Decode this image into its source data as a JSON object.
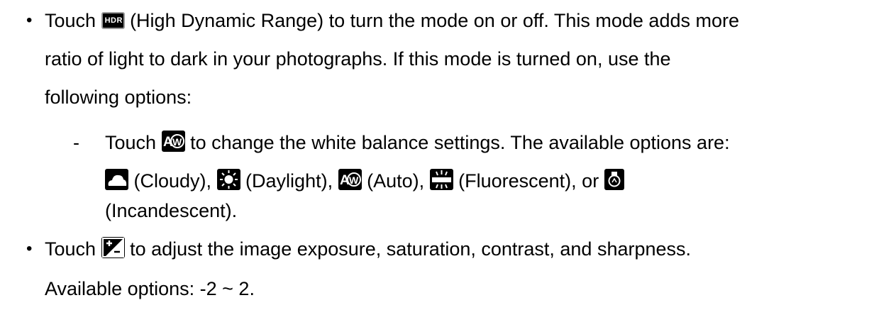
{
  "bullet1": {
    "line1_pre": "Touch ",
    "hdr_icon_text": "HDR",
    "line1_post": " (High Dynamic Range) to turn the mode on or off. This mode adds more",
    "line2": "ratio of light to dark in your photographs. If this mode is turned on, use the",
    "line3": "following options:"
  },
  "sub": {
    "dash": "-",
    "line1_pre": "Touch ",
    "line1_post": " to change the white balance settings. The available options are:",
    "cloudy": " (Cloudy), ",
    "daylight": " (Daylight), ",
    "auto": " (Auto), ",
    "fluorescent": " (Fluorescent), or ",
    "line3": "(Incandescent)."
  },
  "bullet2": {
    "line1_pre": "Touch ",
    "line1_post": " to adjust the image exposure, saturation, contrast, and sharpness.",
    "line2": "Available options: -2  ~ 2."
  },
  "bullet_char": "•",
  "icons": [
    "hdr-icon",
    "auto-white-balance-icon",
    "cloudy-icon",
    "daylight-icon",
    "fluorescent-icon",
    "incandescent-icon",
    "exposure-icon"
  ]
}
